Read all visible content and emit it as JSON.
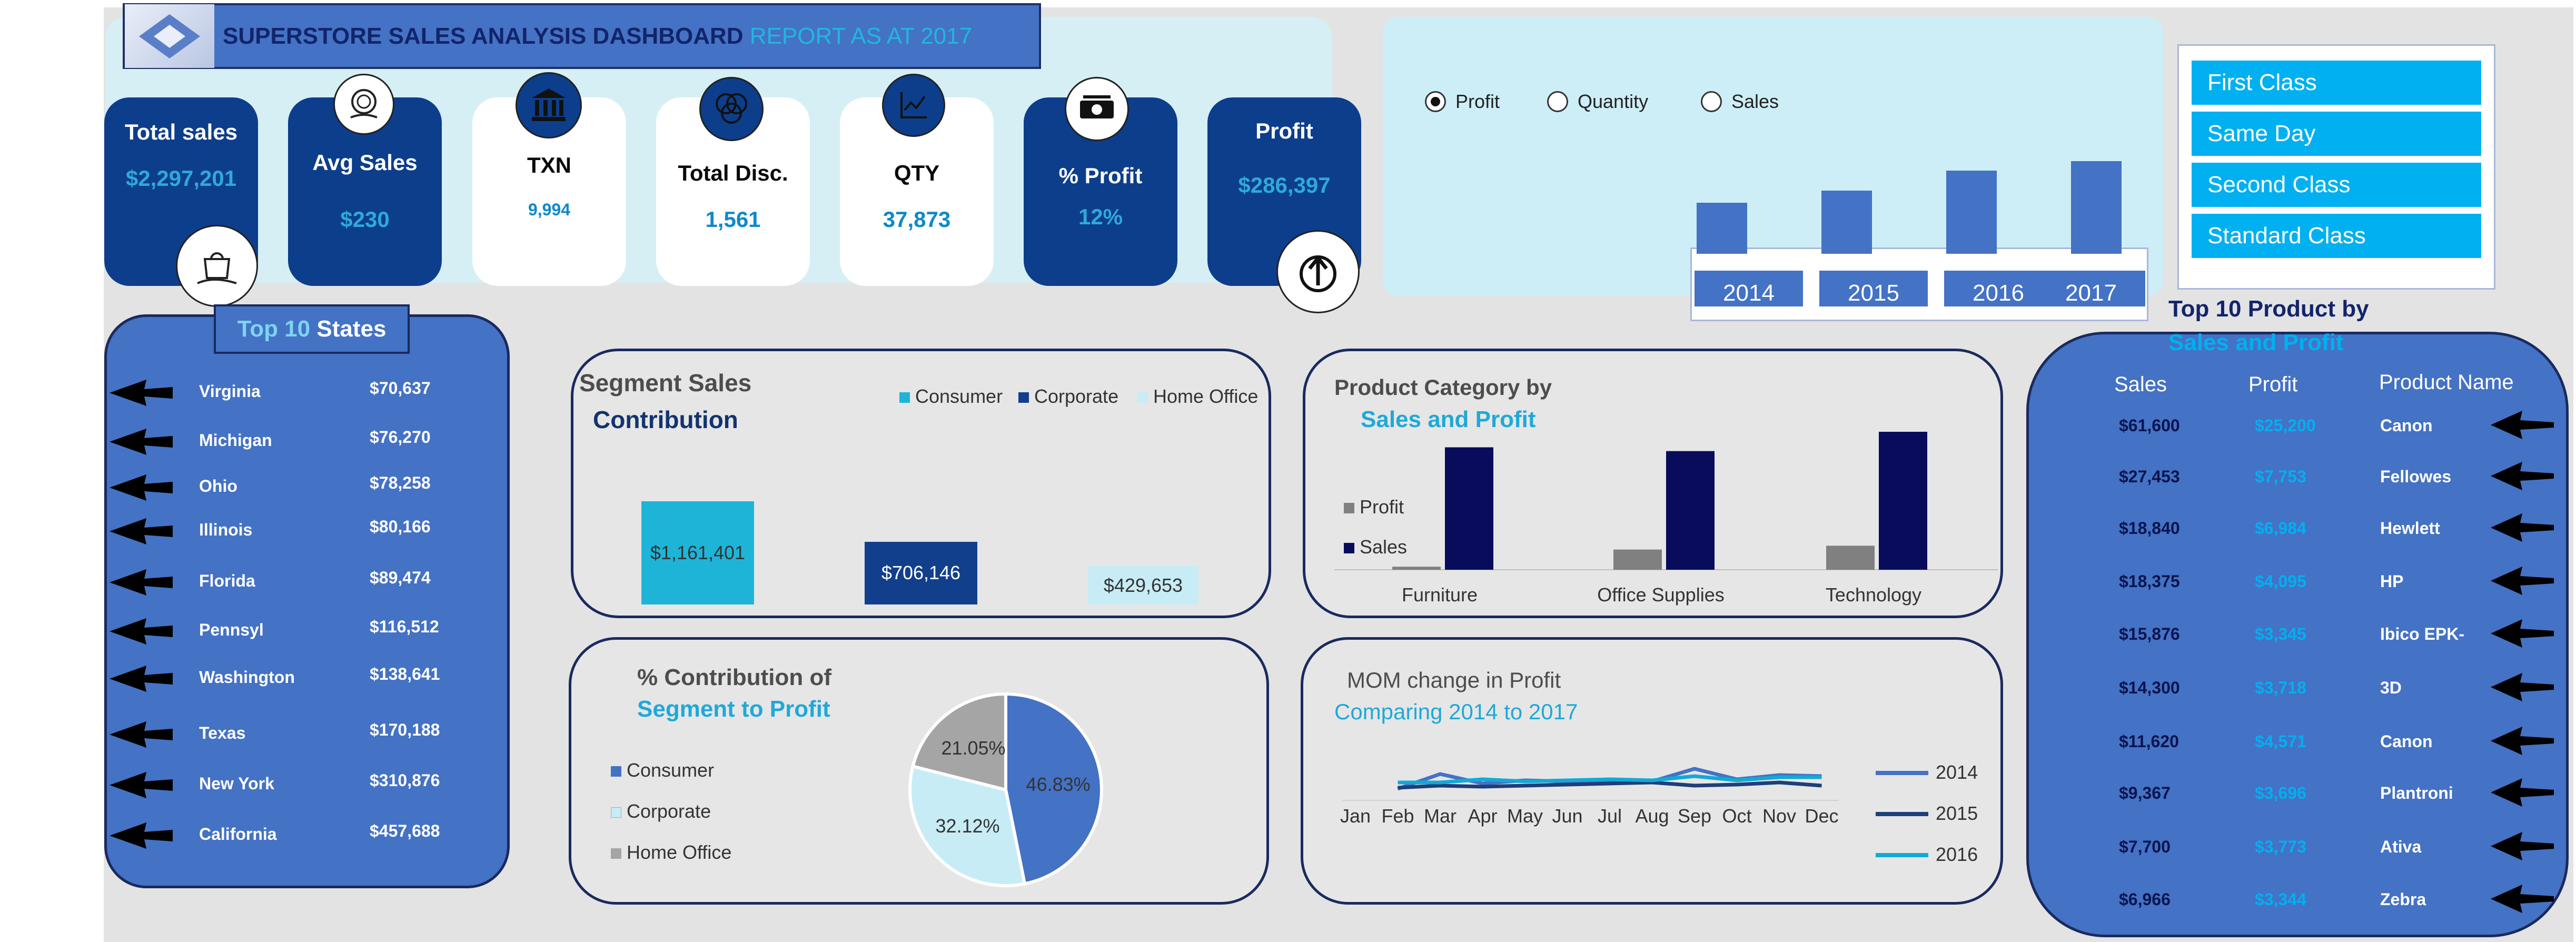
{
  "header": {
    "title": "SUPERSTORE SALES ANALYSIS DASHBOARD",
    "subtitle": "REPORT AS AT 2017"
  },
  "kpis": [
    {
      "label": "Total sales",
      "value": "$2,297,201"
    },
    {
      "label": "Avg Sales",
      "value": "$230"
    },
    {
      "label": "TXN",
      "value": "9,994"
    },
    {
      "label": "Total Disc.",
      "value": "1,561"
    },
    {
      "label": "QTY",
      "value": "37,873"
    },
    {
      "label": "% Profit",
      "value": "12%"
    },
    {
      "label": "Profit",
      "value": "$286,397"
    }
  ],
  "icons": {
    "sales": "shopping-bag-icon",
    "avg": "money-hand-icon",
    "txn": "bank-icon",
    "disc": "venn-icon",
    "qty": "chart-icon",
    "pct": "cash-icon",
    "profit": "growth-icon"
  },
  "year_selector": {
    "options": [
      "Profit",
      "Quantity",
      "Sales"
    ],
    "selected": "Profit",
    "years": [
      "2014",
      "2015",
      "2016",
      "2017"
    ],
    "bar_levels": [
      0.55,
      0.68,
      0.9,
      1.0
    ]
  },
  "ship_modes": [
    "First Class",
    "Same Day",
    "Second Class",
    "Standard Class"
  ],
  "top_states": {
    "title_a": "Top 10",
    "title_b": "States",
    "rows": [
      {
        "state": "Virginia",
        "value": "$70,637"
      },
      {
        "state": "Michigan",
        "value": "$76,270"
      },
      {
        "state": "Ohio",
        "value": "$78,258"
      },
      {
        "state": "Illinois",
        "value": "$80,166"
      },
      {
        "state": "Florida",
        "value": "$89,474"
      },
      {
        "state": "Pennsyl",
        "value": "$116,512"
      },
      {
        "state": "Washington",
        "value": "$138,641"
      },
      {
        "state": "Texas",
        "value": "$170,188"
      },
      {
        "state": "New York",
        "value": "$310,876"
      },
      {
        "state": "California",
        "value": "$457,688"
      }
    ]
  },
  "segment_sales": {
    "title_a": "Segment Sales",
    "title_b": "Contribution",
    "legend": [
      "Consumer",
      "Corporate",
      "Home Office"
    ],
    "colors": [
      "#1eb4d8",
      "#123f8c",
      "#c7ecf5"
    ],
    "values": [
      1161401,
      706146,
      429653
    ],
    "labels": [
      "$1,161,401",
      "$706,146",
      "$429,653"
    ]
  },
  "category": {
    "title_a": "Product Category by",
    "title_b": "Sales and Profit",
    "legend": [
      "Profit",
      "Sales"
    ],
    "categories": [
      "Furniture",
      "Office Supplies",
      "Technology"
    ],
    "profit": [
      18451,
      122491,
      145455
    ],
    "sales": [
      741999,
      719047,
      836154
    ]
  },
  "segment_profit": {
    "title_a": "% Contribution of",
    "title_b": "Segment to Profit",
    "legend": [
      "Consumer",
      "Corporate",
      "Home Office"
    ],
    "colors": [
      "#4472c4",
      "#c7ecf5",
      "#a5a5a5"
    ],
    "values": [
      46.83,
      32.12,
      21.05
    ],
    "labels": [
      "46.83%",
      "32.12%",
      "21.05%"
    ]
  },
  "mom": {
    "title_a": "MOM change in Profit",
    "title_b": "Comparing 2014 to 2017",
    "months": [
      "Jan",
      "Feb",
      "Mar",
      "Apr",
      "May",
      "Jun",
      "Jul",
      "Aug",
      "Sep",
      "Oct",
      "Nov",
      "Dec"
    ],
    "legend": [
      "2014",
      "2015",
      "2016"
    ]
  },
  "top_products": {
    "title_a": "Top 10 Product by",
    "title_b": "Sales and Profit",
    "headers": [
      "Sales",
      "Profit",
      "Product Name"
    ],
    "rows": [
      {
        "sales": "$61,600",
        "profit": "$25,200",
        "name": "Canon"
      },
      {
        "sales": "$27,453",
        "profit": "$7,753",
        "name": "Fellowes"
      },
      {
        "sales": "$18,840",
        "profit": "$6,984",
        "name": "Hewlett"
      },
      {
        "sales": "$18,375",
        "profit": "$4,095",
        "name": "HP"
      },
      {
        "sales": "$15,876",
        "profit": "$3,345",
        "name": "Ibico EPK-"
      },
      {
        "sales": "$14,300",
        "profit": "$3,718",
        "name": "3D"
      },
      {
        "sales": "$11,620",
        "profit": "$4,571",
        "name": "Canon"
      },
      {
        "sales": "$9,367",
        "profit": "$3,696",
        "name": "Plantroni"
      },
      {
        "sales": "$7,700",
        "profit": "$3,773",
        "name": "Ativa"
      },
      {
        "sales": "$6,966",
        "profit": "$3,344",
        "name": "Zebra"
      }
    ]
  }
}
